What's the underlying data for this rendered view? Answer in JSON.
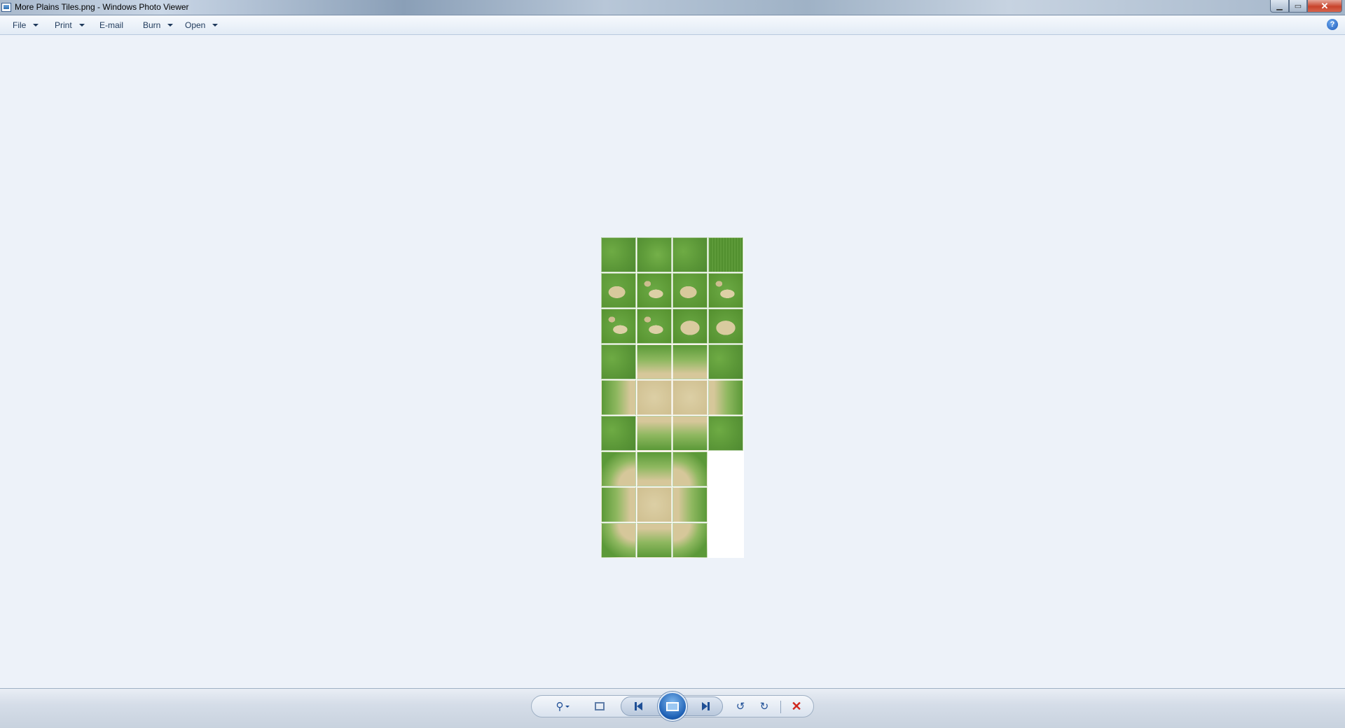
{
  "window": {
    "title": "More Plains Tiles.png - Windows Photo Viewer",
    "minimize_glyph": "▁",
    "maximize_glyph": "▭",
    "close_glyph": "✕"
  },
  "menu": {
    "items": [
      {
        "label": "File",
        "has_dropdown": true
      },
      {
        "label": "Print",
        "has_dropdown": true
      },
      {
        "label": "E-mail",
        "has_dropdown": false
      },
      {
        "label": "Burn",
        "has_dropdown": true
      },
      {
        "label": "Open",
        "has_dropdown": true
      }
    ],
    "help_glyph": "?"
  },
  "image": {
    "filename": "More Plains Tiles.png"
  },
  "toolbar": {
    "zoom_glyph": "⚲",
    "rotate_left_glyph": "↺",
    "rotate_right_glyph": "↻",
    "delete_glyph": "✕",
    "icons": [
      "zoom-icon",
      "fit-to-window-icon",
      "previous-icon",
      "slideshow-icon",
      "next-icon",
      "rotate-left-icon",
      "rotate-right-icon",
      "delete-icon"
    ]
  },
  "colors": {
    "accent": "#1f4f96",
    "delete": "#d0261d",
    "viewer_background": "#edf2f9"
  }
}
